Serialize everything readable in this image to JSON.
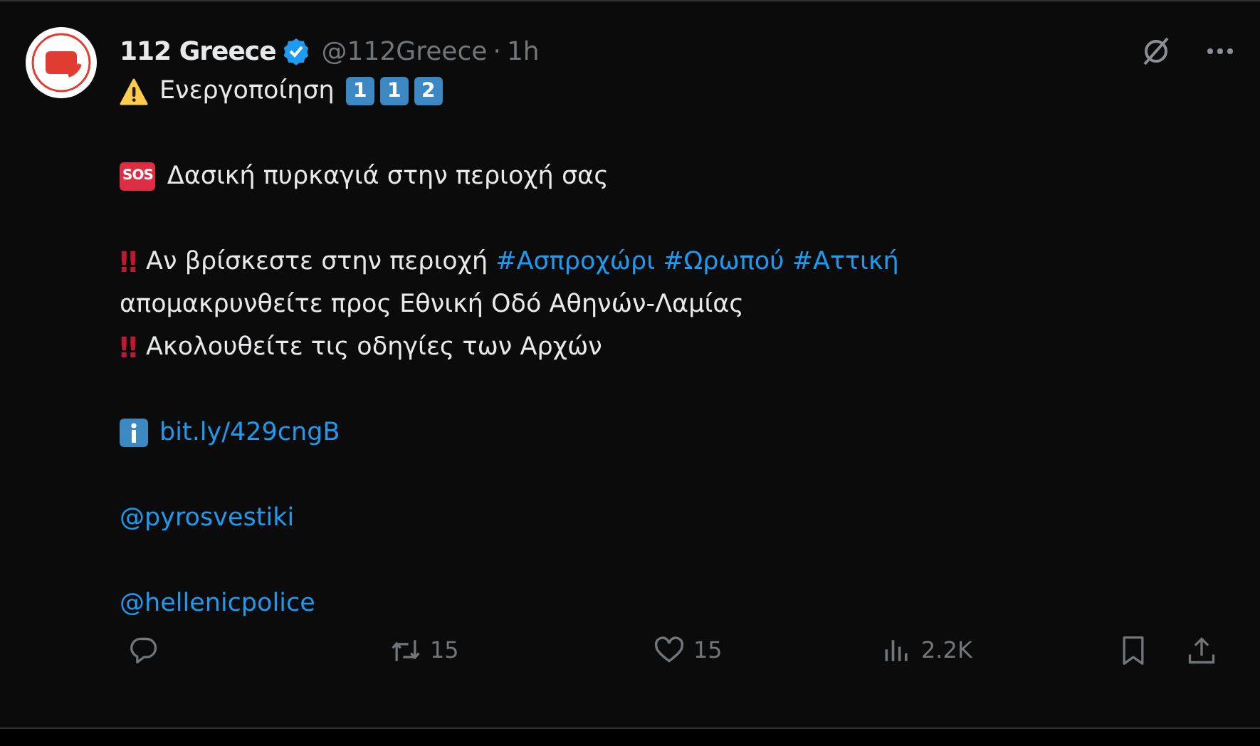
{
  "author": {
    "name": "112 Greece",
    "verified": true,
    "handle": "@112Greece",
    "separator": "·",
    "time": "1h"
  },
  "paragraphs": [
    {
      "lines": [
        {
          "items": [
            {
              "kind": "warning"
            },
            {
              "kind": "sentence",
              "segments": [
                {
                  "kind": "text",
                  "text": "Ενεργοποίηση"
                }
              ]
            },
            {
              "kind": "keycap",
              "text": "1"
            },
            {
              "kind": "keycap",
              "text": "1"
            },
            {
              "kind": "keycap",
              "text": "2"
            }
          ]
        }
      ]
    },
    {
      "lines": [
        {
          "items": [
            {
              "kind": "sos",
              "text": "SOS"
            },
            {
              "kind": "sentence",
              "segments": [
                {
                  "kind": "text",
                  "text": "Δασική πυρκαγιά στην περιοχή σας"
                }
              ]
            }
          ]
        }
      ]
    },
    {
      "lines": [
        {
          "items": [
            {
              "kind": "marks",
              "text": "‼"
            },
            {
              "kind": "sentence",
              "segments": [
                {
                  "kind": "text",
                  "text": "Αν βρίσκεστε στην περιοχή"
                },
                {
                  "kind": "hashtag",
                  "text": "#Ασπροχώρι"
                },
                {
                  "kind": "hashtag",
                  "text": "#Ωρωπού"
                },
                {
                  "kind": "hashtag",
                  "text": "#Αττική"
                }
              ]
            }
          ]
        },
        {
          "items": [
            {
              "kind": "sentence",
              "segments": [
                {
                  "kind": "text",
                  "text": "απομακρυνθείτε προς Εθνική Οδό Αθηνών-Λαμίας"
                }
              ]
            }
          ]
        },
        {
          "items": [
            {
              "kind": "marks",
              "text": "‼"
            },
            {
              "kind": "sentence",
              "segments": [
                {
                  "kind": "text",
                  "text": "Ακολουθείτε τις οδηγίες των Αρχών"
                }
              ]
            }
          ]
        }
      ]
    },
    {
      "lines": [
        {
          "items": [
            {
              "kind": "info"
            },
            {
              "kind": "sentence",
              "segments": [
                {
                  "kind": "link",
                  "text": "bit.ly/429cngB"
                }
              ]
            }
          ]
        }
      ]
    },
    {
      "lines": [
        {
          "items": [
            {
              "kind": "sentence",
              "segments": [
                {
                  "kind": "mention",
                  "text": "@pyrosvestiki"
                }
              ]
            }
          ]
        }
      ]
    },
    {
      "lines": [
        {
          "items": [
            {
              "kind": "sentence",
              "segments": [
                {
                  "kind": "mention",
                  "text": "@hellenicpolice"
                }
              ]
            }
          ]
        }
      ]
    }
  ],
  "actions": [
    {
      "kind": "reply"
    },
    {
      "kind": "repost",
      "count": "15"
    },
    {
      "kind": "like",
      "count": "15"
    },
    {
      "kind": "views",
      "count": "2.2K"
    },
    {
      "kind": "bookmark"
    },
    {
      "kind": "share"
    }
  ]
}
